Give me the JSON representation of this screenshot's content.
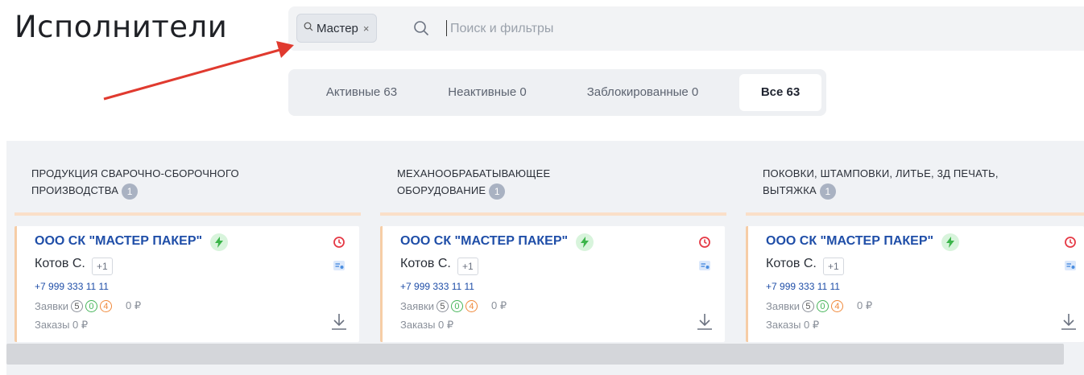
{
  "page": {
    "title": "Исполнители"
  },
  "search": {
    "chip_label": "Мастер",
    "chip_close": "×",
    "placeholder": "Поиск и фильтры",
    "value": ""
  },
  "tabs": [
    {
      "label": "Активные 63"
    },
    {
      "label": "Неактивные 0"
    },
    {
      "label": "Заблокированные 0"
    },
    {
      "label": "Все 63",
      "active": true
    }
  ],
  "columns": [
    {
      "title_line1": "ПРОДУКЦИЯ СВАРОЧНО-СБОРОЧНОГО",
      "title_line2": "ПРОИЗВОДСТВА",
      "count": "1",
      "card": {
        "company": "ООО СК \"МАСТЕР ПАКЕР\"",
        "contact": "Котов С.",
        "extra": "+1",
        "phone": "+7 999 333 11 11",
        "requests_label": "Заявки",
        "req_a": "5",
        "req_b": "0",
        "req_c": "4",
        "requests_amount": "0 ₽",
        "orders": "Заказы  0 ₽"
      }
    },
    {
      "title_line1": "МЕХАНООБРАБАТЫВАЮЩЕЕ",
      "title_line2": "ОБОРУДОВАНИЕ",
      "count": "1",
      "card": {
        "company": "ООО СК \"МАСТЕР ПАКЕР\"",
        "contact": "Котов С.",
        "extra": "+1",
        "phone": "+7 999 333 11 11",
        "requests_label": "Заявки",
        "req_a": "5",
        "req_b": "0",
        "req_c": "4",
        "requests_amount": "0 ₽",
        "orders": "Заказы  0 ₽"
      }
    },
    {
      "title_line1": "ПОКОВКИ, ШТАМПОВКИ, ЛИТЬЕ, 3Д ПЕЧАТЬ,",
      "title_line2": "ВЫТЯЖКА",
      "count": "1",
      "card": {
        "company": "ООО СК \"МАСТЕР ПАКЕР\"",
        "contact": "Котов С.",
        "extra": "+1",
        "phone": "+7 999 333 11 11",
        "requests_label": "Заявки",
        "req_a": "5",
        "req_b": "0",
        "req_c": "4",
        "requests_amount": "0 ₽",
        "orders": "Заказы  0 ₽"
      }
    }
  ],
  "colors": {
    "accent": "#1f4ea8",
    "card_border": "#f6cda6",
    "alert_red": "#e53945",
    "doc_blue": "#4a8de0",
    "arrow_red": "#e03a2f"
  },
  "icons": [
    "search-icon",
    "close-icon",
    "lightning-icon",
    "clock-alert-icon",
    "document-icon",
    "download-icon"
  ]
}
